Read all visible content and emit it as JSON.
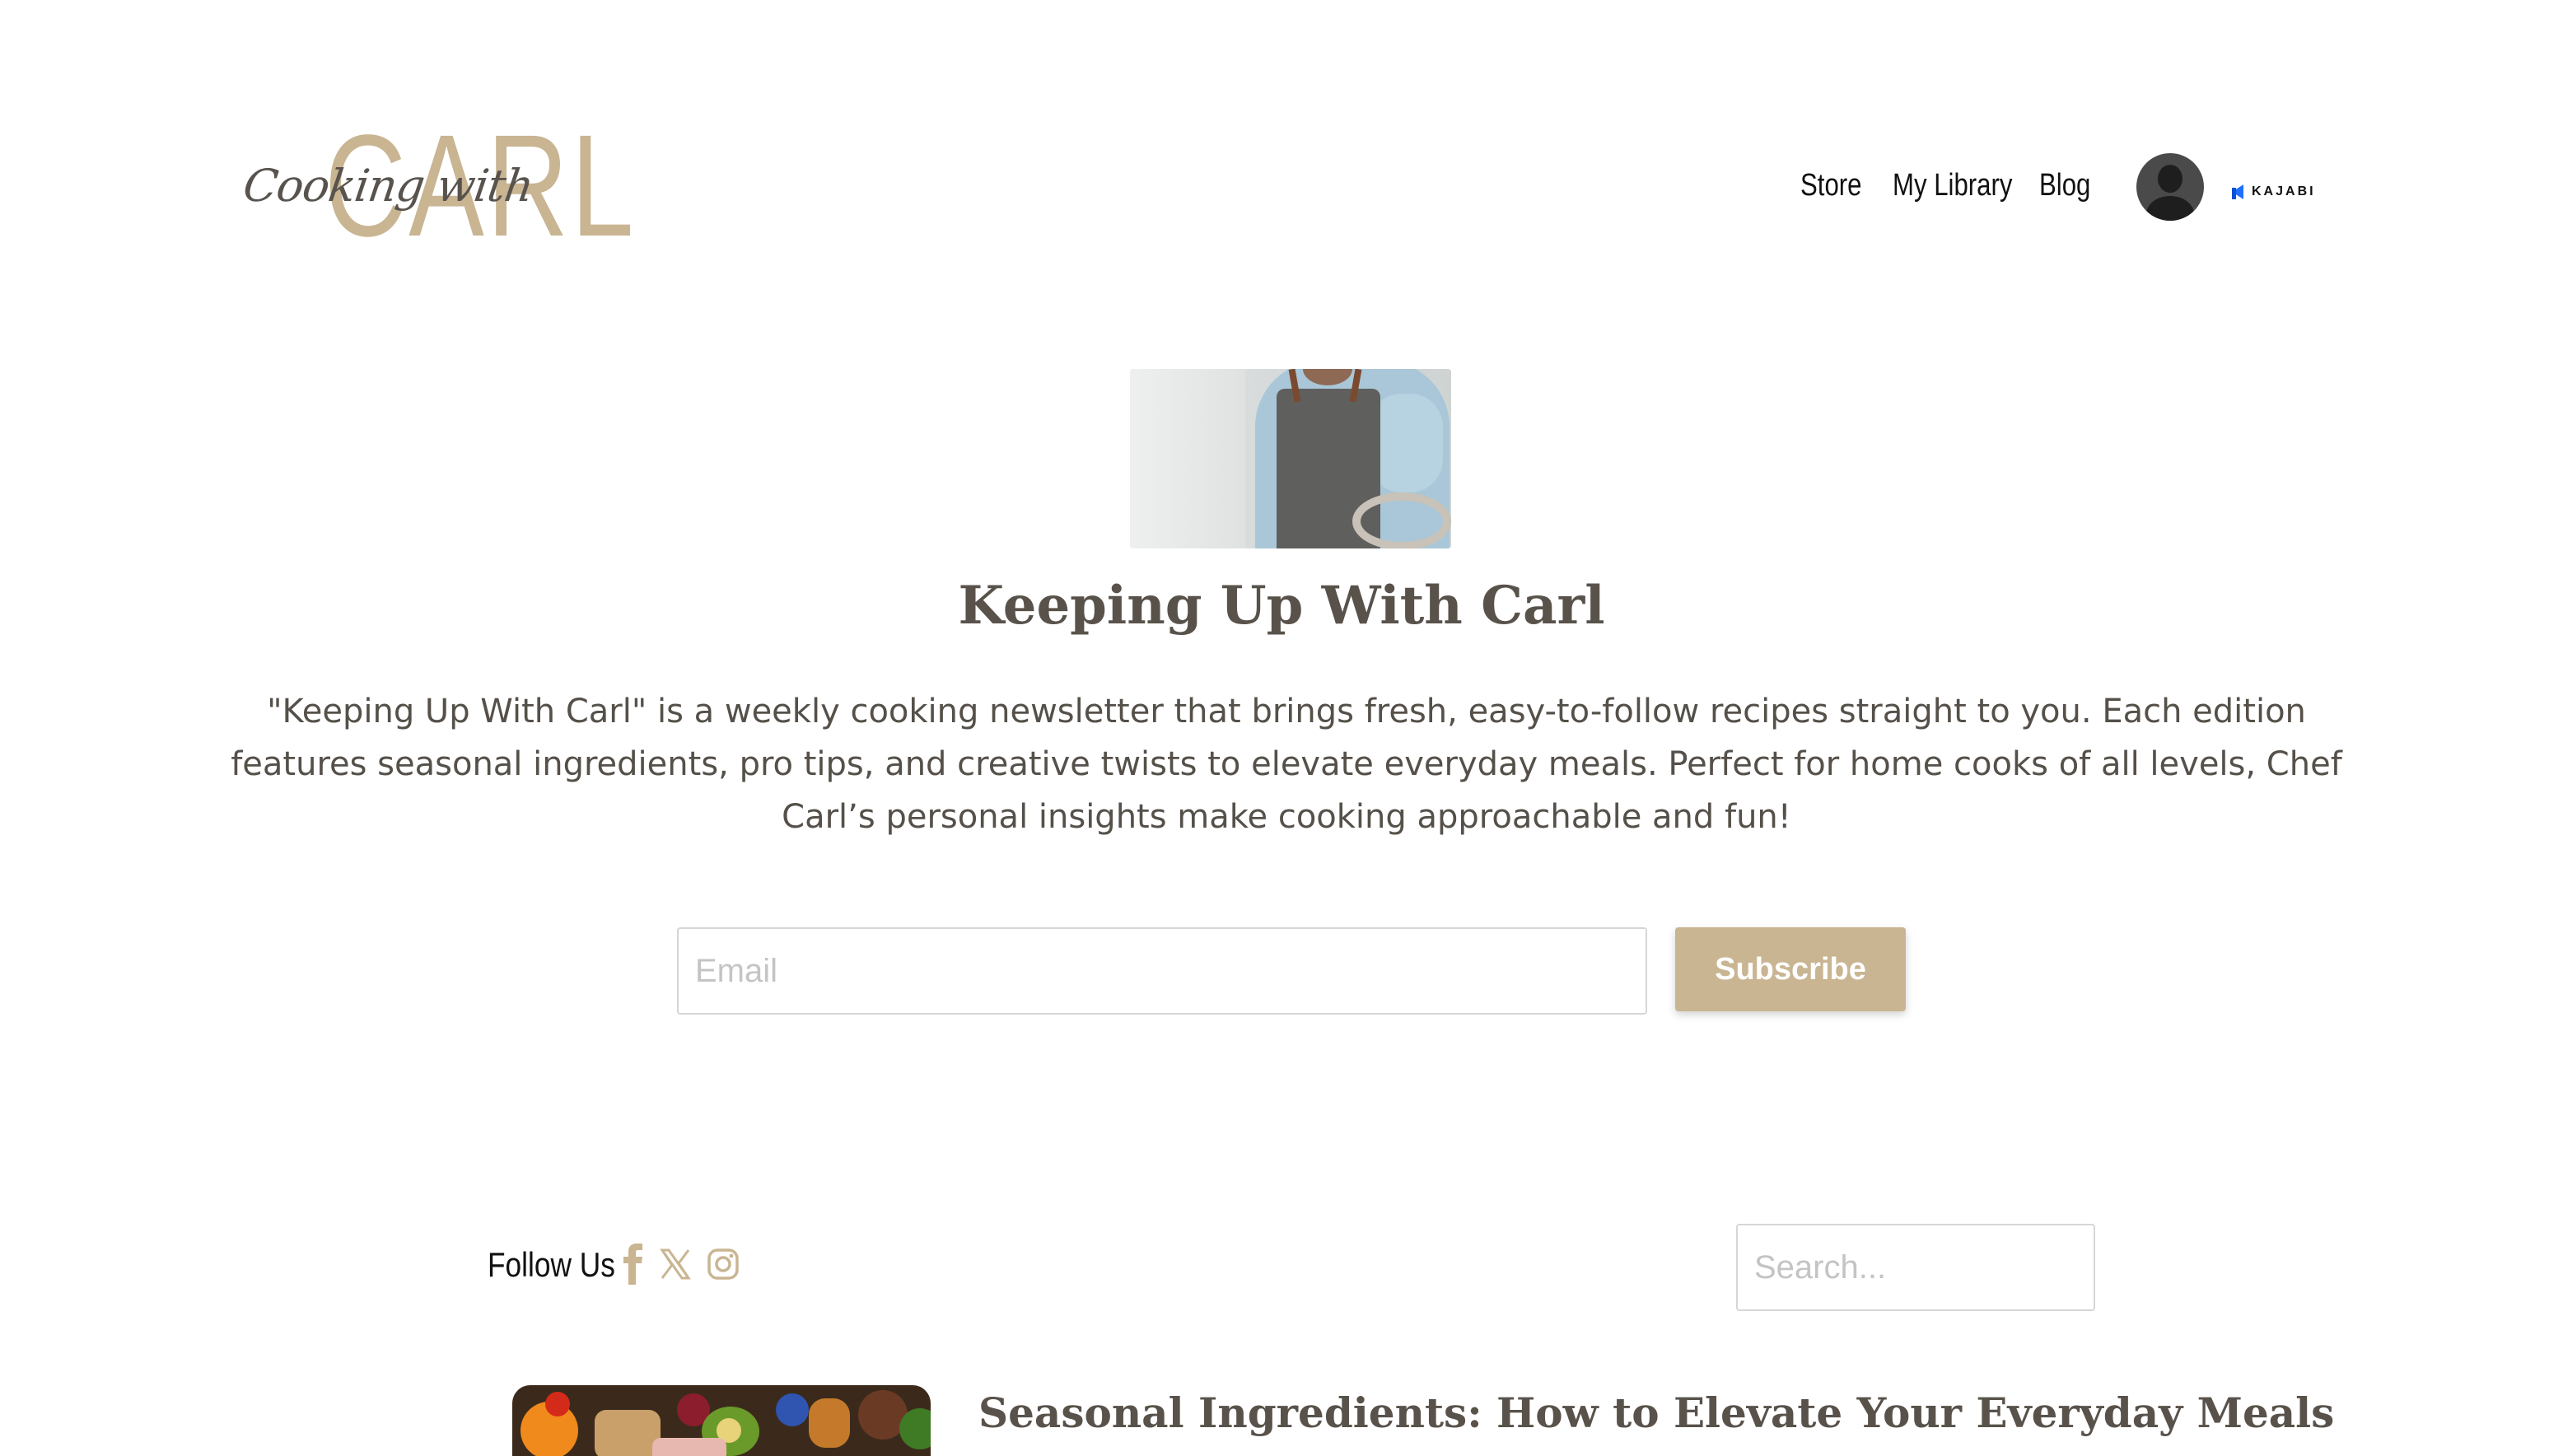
{
  "brand": {
    "logo_script": "Cooking with",
    "logo_main": "CARL"
  },
  "nav": {
    "items": [
      {
        "label": "Store"
      },
      {
        "label": "My Library"
      },
      {
        "label": "Blog"
      }
    ],
    "kajabi_label": "KAJABI"
  },
  "hero": {
    "title": "Keeping Up With Carl",
    "description": "\"Keeping Up With Carl\" is a weekly cooking newsletter that brings fresh, easy-to-follow recipes straight to you. Each edition features seasonal ingredients, pro tips, and creative twists to elevate everyday meals. Perfect for home cooks of all levels, Chef Carl’s personal insights make cooking approachable and fun!"
  },
  "subscribe": {
    "email_placeholder": "Email",
    "email_value": "",
    "button_label": "Subscribe"
  },
  "follow": {
    "label": "Follow Us",
    "icons": [
      "facebook-icon",
      "x-twitter-icon",
      "instagram-icon"
    ]
  },
  "search": {
    "placeholder": "Search..."
  },
  "posts": [
    {
      "title": "Seasonal Ingredients: How to Elevate Your Everyday Meals"
    }
  ],
  "colors": {
    "accent": "#c9b592",
    "heading": "#58524b",
    "body_text": "#555049",
    "kajabi_blue": "#1e6fff"
  }
}
